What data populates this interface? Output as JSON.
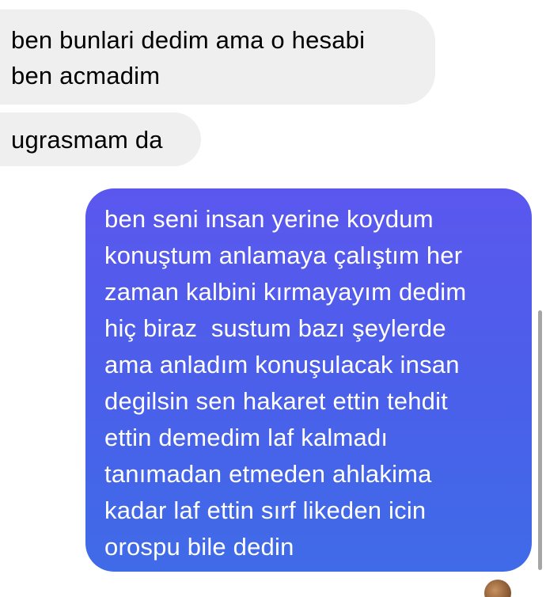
{
  "conversation": {
    "messages": [
      {
        "direction": "incoming",
        "lines": [
          "ben bunlari dedim ama o hesabi",
          "ben acmadim"
        ]
      },
      {
        "direction": "incoming",
        "lines": [
          "ugrasmam da"
        ]
      },
      {
        "direction": "outgoing",
        "lines": [
          "ben seni insan yerine koydum",
          "konuştum anlamaya çalıştım her",
          "zaman kalbini kırmayayım dedim",
          "hiç biraz  sustum bazı şeylerde",
          "ama anladım konuşulacak insan",
          "degilsin sen hakaret ettin tehdit",
          "ettin demedim laf kalmadı",
          "tanımadan etmeden ahlakima",
          "kadar laf ettin sırf likeden icin",
          "orospu bile dedin"
        ]
      }
    ]
  },
  "colors": {
    "incoming_bubble": "#efefef",
    "outgoing_gradient_top": "#5b57ee",
    "outgoing_gradient_bottom": "#3f6be8",
    "scrollbar": "#a6a6a6"
  },
  "icons": {
    "avatar": "avatar"
  }
}
